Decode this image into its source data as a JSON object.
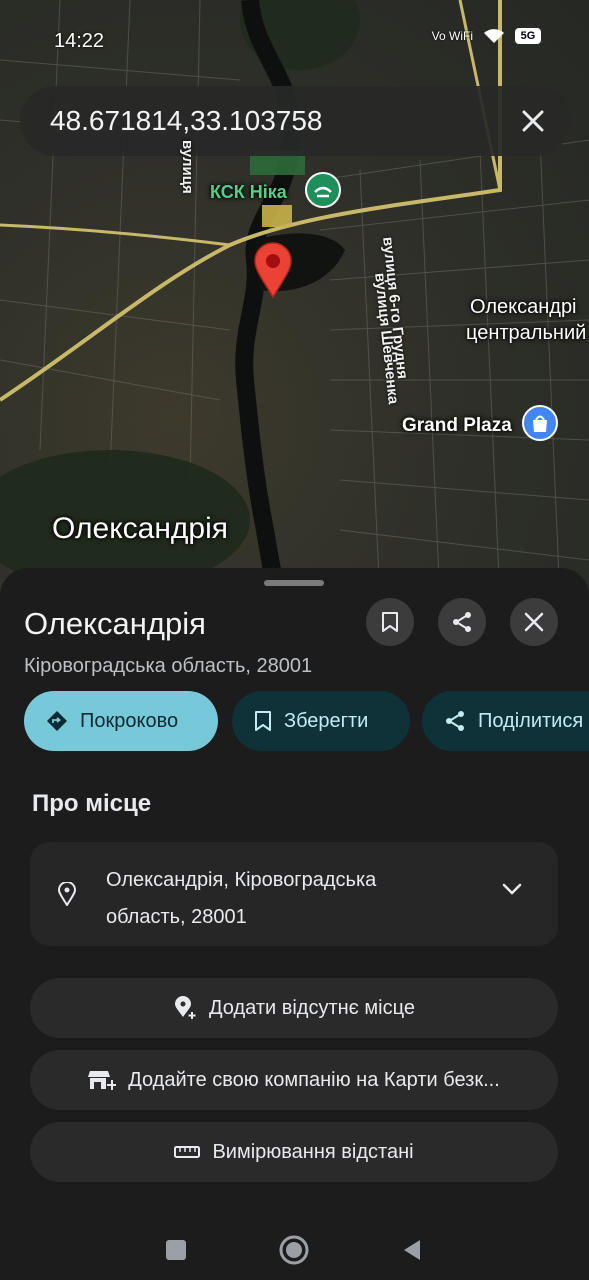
{
  "status": {
    "time": "14:22",
    "network": "Vo WiFi",
    "signal": "5G"
  },
  "search": {
    "query": "48.671814,33.103758"
  },
  "map": {
    "city_label": "Олександрія",
    "poi_ksk": "КСК Ніка",
    "poi_grand_plaza": "Grand Plaza",
    "district_line1": "Олександрі",
    "district_line2": "центральний",
    "street_shevchenka": "вулиця Шевченка",
    "street_6grudnia": "вулиця 6-го Грудня",
    "street_vulytsia": "вулиця"
  },
  "place": {
    "title": "Олександрія",
    "subtitle": "Кіровоградська область, 28001"
  },
  "chips": {
    "directions": "Покроково",
    "save": "Зберегти",
    "share": "Поділитися"
  },
  "about": {
    "title": "Про місце",
    "address": "Олександрія, Кіровоградська область, 28001"
  },
  "actions": {
    "add_missing": "Додати відсутнє місце",
    "add_business": "Додайте свою компанію на Карти безк...",
    "measure": "Вимірювання відстані"
  },
  "colors": {
    "accent": "#77c8d9",
    "pin": "#ea4335",
    "sheet": "#1c1c1c"
  }
}
